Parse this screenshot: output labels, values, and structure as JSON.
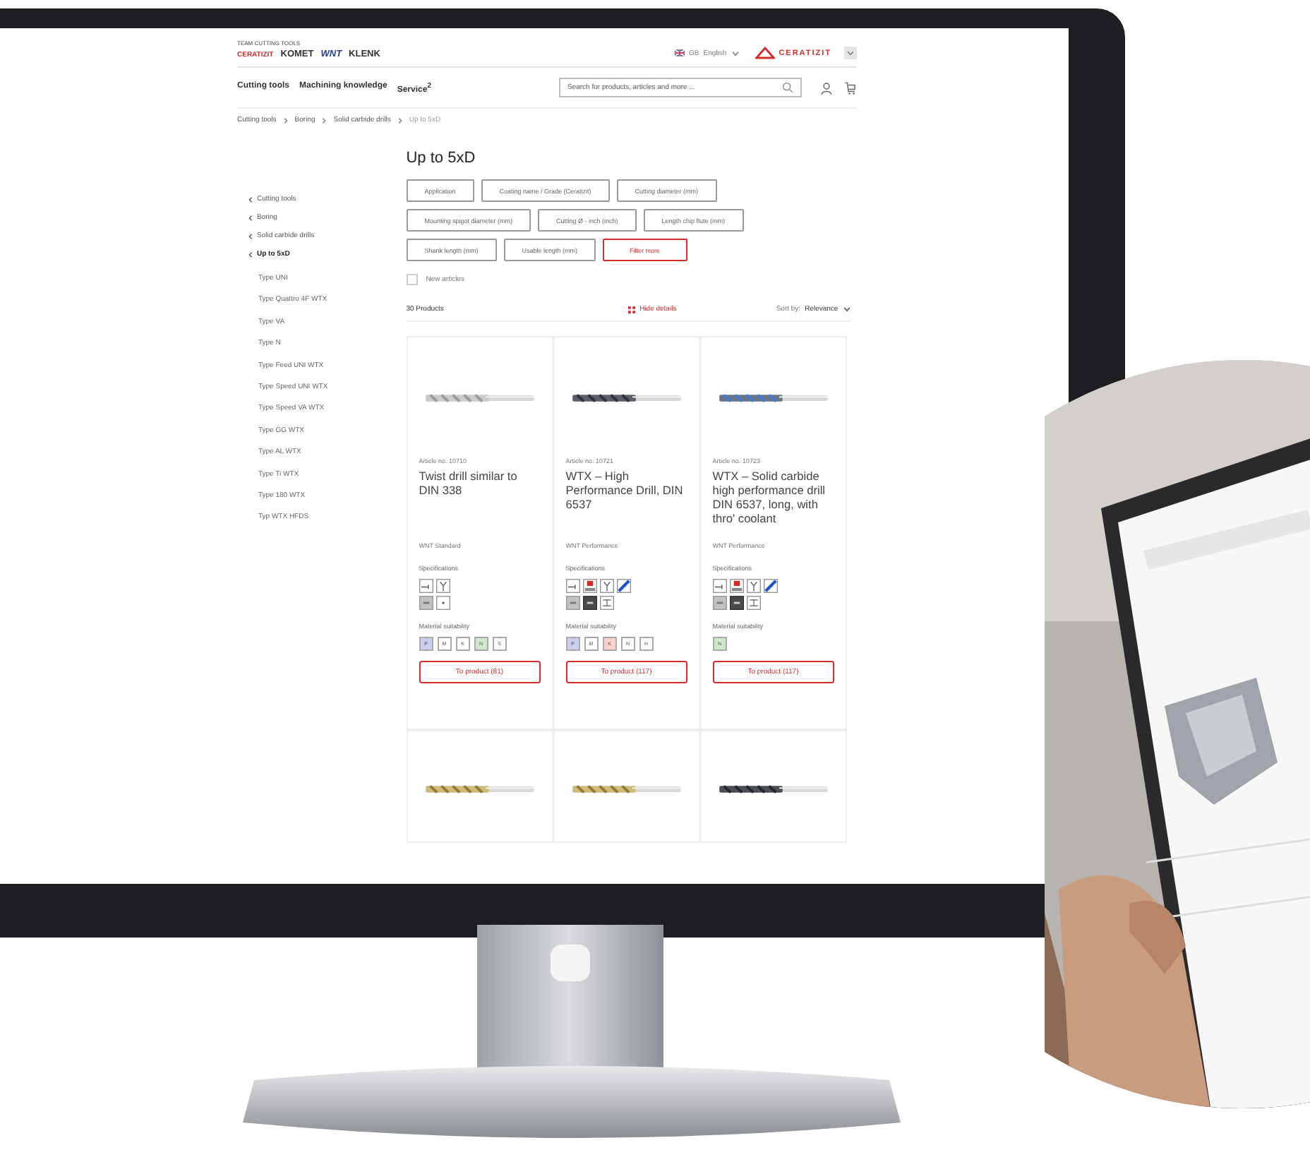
{
  "header": {
    "tagline": "TEAM CUTTING TOOLS",
    "brands": [
      "CERATIZIT",
      "KOMET",
      "WNT",
      "KLENK"
    ],
    "region": "GB",
    "language": "English",
    "brand_logo": "CERATIZIT"
  },
  "nav": {
    "items": [
      "Cutting tools",
      "Machining knowledge",
      "Service$^{2}$"
    ],
    "search": {
      "placeholder": "Search for products, articles and more ..."
    }
  },
  "breadcrumb": [
    "Cutting tools",
    "Boring",
    "Solid carbide drills",
    "Up to 5xD"
  ],
  "sidebar": {
    "back_links": [
      {
        "label": "Cutting tools",
        "selected": false
      },
      {
        "label": "Boring",
        "selected": false
      },
      {
        "label": "Solid carbide drills",
        "selected": false
      },
      {
        "label": "Up to 5xD",
        "selected": true
      }
    ],
    "children": [
      "Type UNI",
      "Type Quattro 4F WTX",
      "Type VA",
      "Type N",
      "Type Feed UNI WTX",
      "Type Speed UNI WTX",
      "Type Speed VA WTX",
      "Type GG WTX",
      "Type AL WTX",
      "Type Ti WTX",
      "Type 180 WTX",
      "Typ WTX HFDS"
    ]
  },
  "title": "Up to 5xD",
  "filters": [
    [
      {
        "label": "Application",
        "kind": "filter"
      },
      {
        "label": "Coating name / Grade (Ceratizit)",
        "kind": "filter"
      },
      {
        "label": "Cutting diameter (mm)",
        "kind": "filter"
      }
    ],
    [
      {
        "label": "Mounting spigot diameter (mm)",
        "kind": "filter"
      },
      {
        "label": "Cutting Ø - inch (inch)",
        "kind": "filter"
      },
      {
        "label": "Length chip flute (mm)",
        "kind": "filter"
      }
    ],
    [
      {
        "label": "Shank length (mm)",
        "kind": "filter"
      },
      {
        "label": "Usable length (mm)",
        "kind": "filter"
      },
      {
        "label": "Filter more",
        "kind": "more"
      }
    ]
  ],
  "new_articles": {
    "label": "New articles",
    "checked": false
  },
  "results": {
    "count": "30 Products",
    "toggle": "Hide details",
    "sort_label": "Sort by:",
    "sort_value": "Relevance"
  },
  "products": [
    {
      "article": "Article no. 10710",
      "name": "Twist drill similar to DIN 338",
      "line": "WNT Standard",
      "specs_label": "Specifications",
      "specs": [
        [
          {
            "kind": "depth"
          },
          {
            "kind": "angle"
          }
        ],
        [
          {
            "kind": "grey"
          },
          {
            "kind": "plain"
          }
        ]
      ],
      "material_label": "Material suitability",
      "materials": [
        {
          "label": "P",
          "color": "#c9cdef"
        },
        {
          "label": "M",
          "color": "#ffffff"
        },
        {
          "label": "K",
          "color": "#ffffff"
        },
        {
          "label": "N",
          "color": "#cfe8cc"
        },
        {
          "label": "S",
          "color": "#ffffff"
        }
      ],
      "button": "To product (81)"
    },
    {
      "article": "Article no. 10721",
      "name": "WTX – High Performance Drill, DIN 6537",
      "line": "WNT Performance",
      "specs_label": "Specifications",
      "specs": [
        [
          {
            "kind": "depth"
          },
          {
            "kind": "red"
          },
          {
            "kind": "angle"
          },
          {
            "kind": "blue"
          }
        ],
        [
          {
            "kind": "grey"
          },
          {
            "kind": "dark"
          },
          {
            "kind": "diagram"
          }
        ]
      ],
      "material_label": "Material suitability",
      "materials": [
        {
          "label": "P",
          "color": "#c9cdef"
        },
        {
          "label": "M",
          "color": "#ffffff"
        },
        {
          "label": "K",
          "color": "#f6d3c6"
        },
        {
          "label": "N",
          "color": "#ffffff"
        },
        {
          "label": "H",
          "color": "#ffffff"
        }
      ],
      "button": "To product (117)"
    },
    {
      "article": "Article no. 10723",
      "name": "WTX – Solid carbide high performance drill DIN 6537, long, with thro' coolant",
      "line": "WNT Performance",
      "specs_label": "Specifications",
      "specs": [
        [
          {
            "kind": "depth"
          },
          {
            "kind": "red"
          },
          {
            "kind": "angle"
          },
          {
            "kind": "blue"
          }
        ],
        [
          {
            "kind": "grey"
          },
          {
            "kind": "dark"
          },
          {
            "kind": "diagram"
          }
        ]
      ],
      "material_label": "Material suitability",
      "materials": [
        {
          "label": "N",
          "color": "#cfe8cc"
        }
      ],
      "button": "To product (117)"
    }
  ],
  "more_products": [
    {
      "kind": "picture"
    },
    {
      "kind": "picture"
    },
    {
      "kind": "picture"
    }
  ]
}
